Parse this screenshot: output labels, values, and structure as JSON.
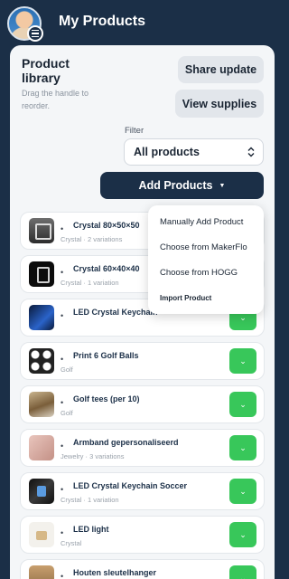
{
  "header": {
    "title": "My Products"
  },
  "library": {
    "title": "Product library",
    "hint": "Drag the handle to reorder.",
    "share_button": "Share update",
    "supplies_button": "View supplies",
    "filter_label": "Filter",
    "filter_value": "All products",
    "add_button": "Add Products",
    "add_caret": "▼"
  },
  "add_menu": {
    "items": [
      "Manually Add Product",
      "Choose from MakerFlo",
      "Choose from HOGG",
      "Import Product"
    ]
  },
  "products": [
    {
      "name": "Crystal 80×50×50",
      "meta": "Crystal · 2 variations"
    },
    {
      "name": "Crystal 60×40×40",
      "meta": "Crystal · 1 variation"
    },
    {
      "name": "LED Crystal Keychain",
      "meta": ""
    },
    {
      "name": "Print 6 Golf Balls",
      "meta": "Golf"
    },
    {
      "name": "Golf tees (per 10)",
      "meta": "Golf"
    },
    {
      "name": "Armband gepersonaliseerd",
      "meta": "Jewelry · 3 variations"
    },
    {
      "name": "LED Crystal Keychain Soccer",
      "meta": "Crystal · 1 variation"
    },
    {
      "name": "LED light",
      "meta": "Crystal"
    },
    {
      "name": "Houten sleutelhanger",
      "meta": ""
    }
  ],
  "symbols": {
    "drag": "•",
    "chevron": "⌄"
  },
  "colors": {
    "brand_navy": "#1b2f47",
    "action_green": "#38c75a",
    "panel": "#f4f6f8"
  }
}
